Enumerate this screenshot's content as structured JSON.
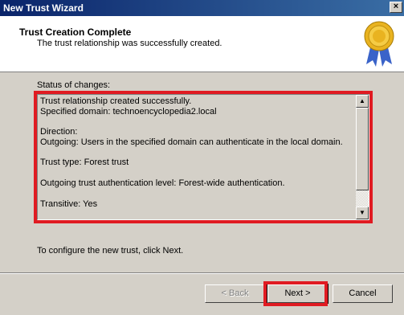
{
  "window": {
    "title": "New Trust Wizard",
    "close_glyph": "×"
  },
  "header": {
    "title": "Trust Creation Complete",
    "subtitle": "The trust relationship was successfully created.",
    "icon": "award-seal-icon"
  },
  "status": {
    "label": "Status of changes:",
    "lines": [
      "Trust relationship created successfully.",
      "Specified domain: technoencyclopedia2.local",
      "",
      "Direction:",
      "Outgoing: Users in the specified domain can authenticate in the local domain.",
      "",
      "Trust type: Forest trust",
      "",
      "Outgoing trust authentication level: Forest-wide authentication.",
      "",
      "Transitive: Yes"
    ],
    "scroll_up_glyph": "▲",
    "scroll_down_glyph": "▼"
  },
  "footer": {
    "instruction": "To configure the new trust, click Next."
  },
  "buttons": {
    "back": "< Back",
    "next": "Next >",
    "cancel": "Cancel"
  },
  "colors": {
    "highlight": "#e01b22",
    "titlebar": "#0a246a"
  }
}
